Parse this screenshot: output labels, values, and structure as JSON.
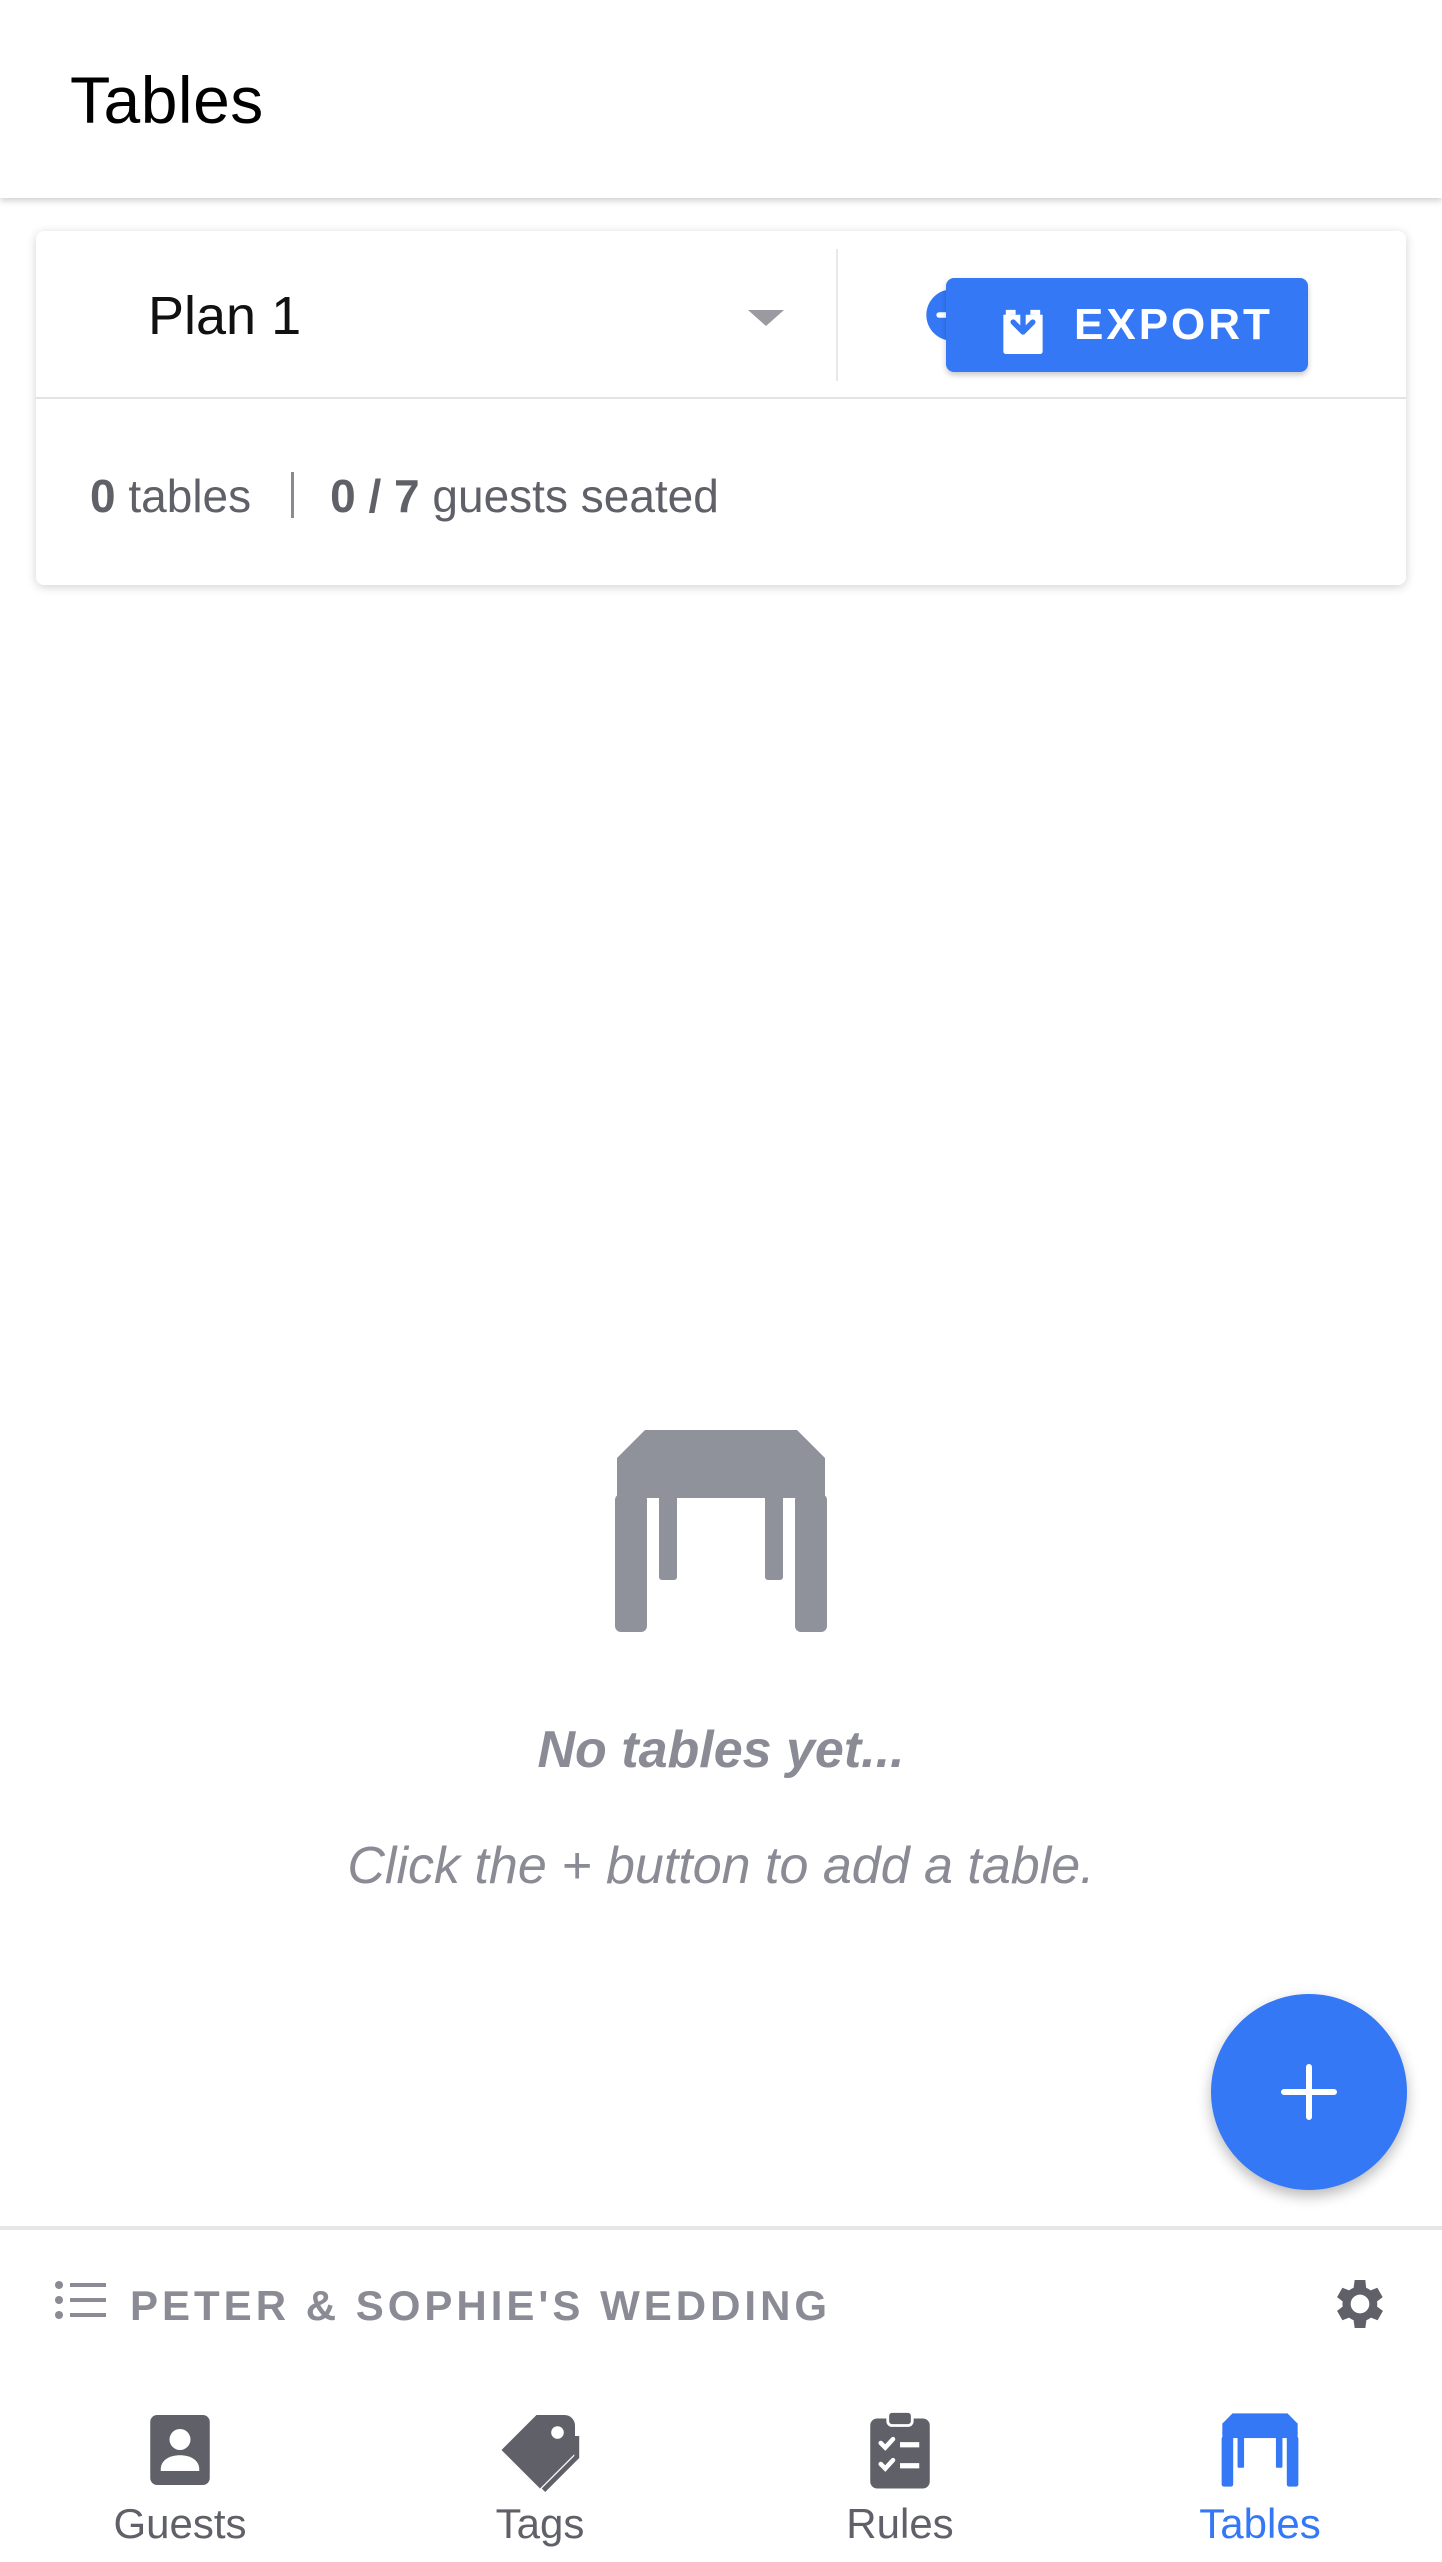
{
  "header": {
    "title": "Tables"
  },
  "plan": {
    "selected": "Plan 1",
    "stats": {
      "tables_count": "0",
      "tables_label": "tables",
      "seated": "0 / 7",
      "seated_label": "guests seated"
    },
    "export_label": "EXPORT"
  },
  "empty_state": {
    "title": "No tables yet...",
    "hint": "Click the + button to add a table."
  },
  "event": {
    "name": "PETER & SOPHIE'S WEDDING"
  },
  "tabs": [
    {
      "label": "Guests",
      "icon": "guests-icon"
    },
    {
      "label": "Tags",
      "icon": "tag-icon"
    },
    {
      "label": "Rules",
      "icon": "clipboard-icon"
    },
    {
      "label": "Tables",
      "icon": "table-icon",
      "active": true
    }
  ],
  "colors": {
    "accent": "#3478f6",
    "muted": "#8a8b94",
    "icon_gray": "#5f6068"
  }
}
